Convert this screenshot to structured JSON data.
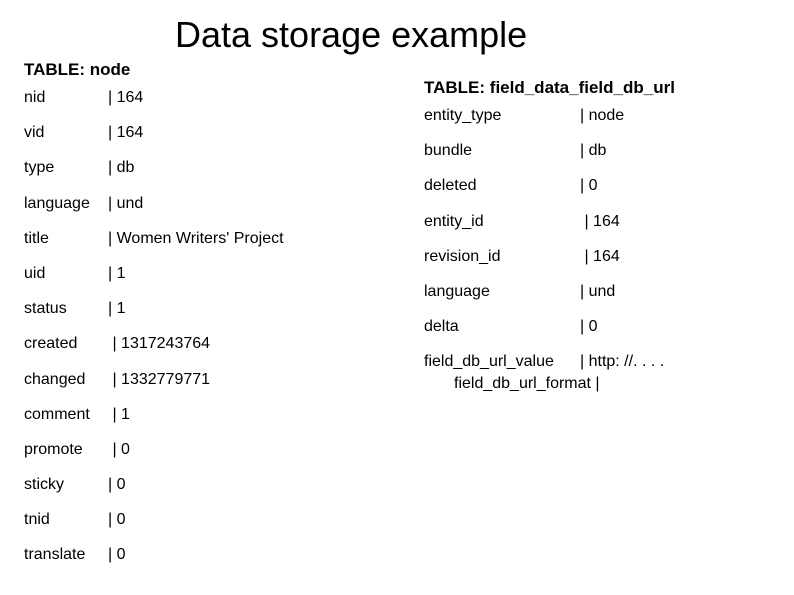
{
  "title": "Data storage example",
  "left": {
    "label": "TABLE: node",
    "rows": [
      {
        "k": "nid",
        "v": "| 164"
      },
      {
        "k": "vid",
        "v": "| 164"
      },
      {
        "k": "type",
        "v": "| db"
      },
      {
        "k": "language",
        "v": "| und"
      },
      {
        "k": "title",
        "v": "| Women Writers' Project"
      },
      {
        "k": "uid",
        "v": "| 1"
      },
      {
        "k": "status",
        "v": "| 1"
      },
      {
        "k": "created",
        "v": " | 1317243764"
      },
      {
        "k": "changed",
        "v": " | 1332779771"
      },
      {
        "k": "comment",
        "v": " | 1"
      },
      {
        "k": "promote",
        "v": " | 0"
      },
      {
        "k": "sticky",
        "v": "| 0"
      },
      {
        "k": "tnid",
        "v": "| 0"
      },
      {
        "k": "translate",
        "v": "| 0"
      }
    ]
  },
  "right": {
    "label": "TABLE: field_data_field_db_url",
    "rows": [
      {
        "k": "entity_type",
        "v": "| node"
      },
      {
        "k": "bundle",
        "v": "| db"
      },
      {
        "k": "deleted",
        "v": "| 0"
      },
      {
        "k": "entity_id",
        "v": " | 164"
      },
      {
        "k": "revision_id",
        "v": " | 164"
      },
      {
        "k": "language",
        "v": "| und"
      },
      {
        "k": "delta",
        "v": "| 0"
      }
    ],
    "last_k": "field_db_url_value",
    "last_v": "| http: //. . . .",
    "last_cont": "field_db_url_format |"
  }
}
